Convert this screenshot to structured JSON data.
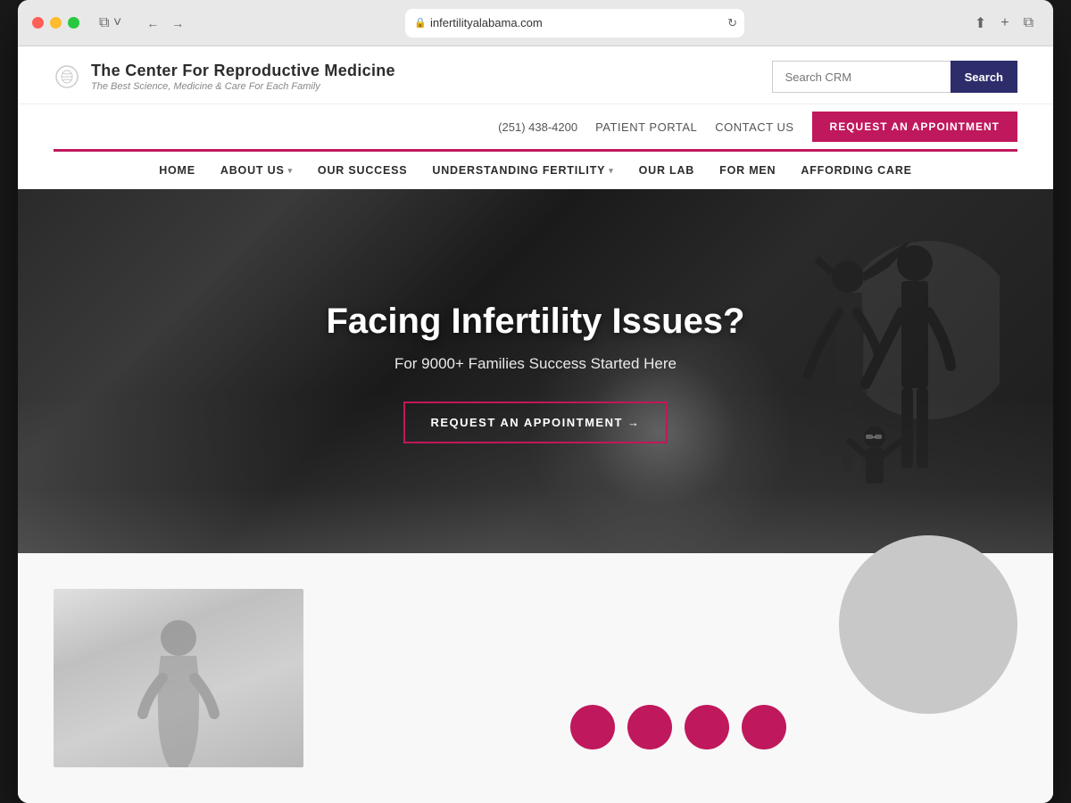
{
  "browser": {
    "url": "infertilityalabama.com",
    "back_label": "←",
    "forward_label": "→",
    "refresh_label": "↻",
    "share_label": "⬆",
    "add_tab_label": "+",
    "tabs_label": "⧉"
  },
  "header": {
    "logo_title": "The Center For Reproductive Medicine",
    "logo_subtitle": "The Best Science, Medicine & Care For Each Family",
    "search_placeholder": "Search CRM",
    "search_button_label": "Search"
  },
  "utility_nav": {
    "phone": "(251) 438-4200",
    "patient_portal": "PATIENT PORTAL",
    "contact_us": "CONTACT US",
    "cta_label": "REQUEST AN APPOINTMENT"
  },
  "main_nav": {
    "items": [
      {
        "label": "HOME",
        "has_dropdown": false,
        "active": false
      },
      {
        "label": "ABOUT US",
        "has_dropdown": true,
        "active": false
      },
      {
        "label": "OUR SUCCESS",
        "has_dropdown": false,
        "active": false
      },
      {
        "label": "UNDERSTANDING FERTILITY",
        "has_dropdown": true,
        "active": false
      },
      {
        "label": "OUR LAB",
        "has_dropdown": false,
        "active": false
      },
      {
        "label": "FOR MEN",
        "has_dropdown": false,
        "active": false
      },
      {
        "label": "AFFORDING CARE",
        "has_dropdown": false,
        "active": false
      }
    ]
  },
  "hero": {
    "title": "Facing Infertility Issues?",
    "subtitle": "For 9000+ Families Success Started Here",
    "cta_label": "REQUEST AN APPOINTMENT →"
  },
  "colors": {
    "pink": "#c0185c",
    "dark_navy": "#2d2d6b",
    "text_dark": "#2c2c2c"
  }
}
